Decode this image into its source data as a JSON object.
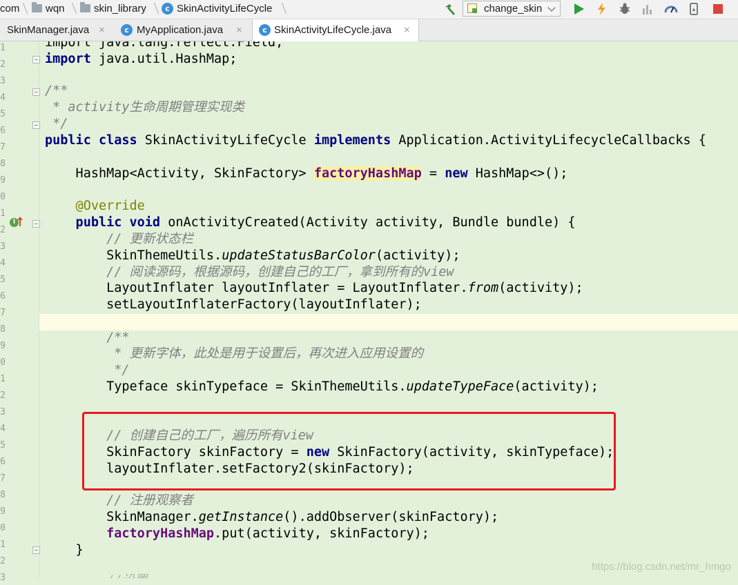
{
  "breadcrumb": {
    "items": [
      "com",
      "wqn",
      "skin_library",
      "SkinActivityLifeCycle"
    ],
    "class_icon_letter": "c"
  },
  "toolbar": {
    "run_config": "change_skin",
    "icons": [
      "build-hammer-icon",
      "run-icon",
      "apply-changes-icon",
      "debug-icon",
      "profile-icon",
      "attach-debugger-icon",
      "device-manager-icon",
      "stop-icon"
    ]
  },
  "tabs": [
    {
      "label": "SkinManager.java",
      "close": "×",
      "active": false
    },
    {
      "label": "MyApplication.java",
      "close": "×",
      "active": false
    },
    {
      "label": "SkinActivityLifeCycle.java",
      "close": "×",
      "active": true
    }
  ],
  "gutter": {
    "line_number_digits": [
      "1",
      "2",
      "3",
      "4",
      "5",
      "6",
      "7",
      "8",
      "9",
      "0",
      "1",
      "2",
      "3",
      "4",
      "5",
      "6",
      "7",
      "8",
      "9",
      "0",
      "1",
      "2",
      "3",
      "4",
      "5",
      "6",
      "7",
      "8",
      "9",
      "0",
      "1",
      "2",
      "3"
    ],
    "override_marker": "I"
  },
  "code": {
    "l01a": "import java.lang.reflect.Field;",
    "l02_kw": "import",
    "l02_rest": " java.util.HashMap;",
    "l04": "/**",
    "l05_star": " * ",
    "l05_word": "activity",
    "l05_cjk": "生命周期管理实现类",
    "l06": " */",
    "l07_kw1": "public class",
    "l07_name": " SkinActivityLifeCycle ",
    "l07_kw2": "implements",
    "l07_rest": " Application.ActivityLifecycleCallbacks {",
    "l09_type": "    HashMap<Activity, SkinFactory> ",
    "l09_field": "factoryHashMap",
    "l09_eq": " = ",
    "l09_kw": "new",
    "l09_rest": " HashMap<>();",
    "l11_ann": "    @Override",
    "l12_kw": "    public void",
    "l12_rest": " onActivityCreated(Activity activity, Bundle bundle) {",
    "l13_cmt": "        // 更新状态栏",
    "l14_a": "        SkinThemeUtils.",
    "l14_it": "updateStatusBarColor",
    "l14_b": "(activity);",
    "l15_cmt": "        // 阅读源码，根据源码，创建自己的工厂，拿到所有的view",
    "l16_a": "        LayoutInflater layoutInflater = LayoutInflater.",
    "l16_it": "from",
    "l16_b": "(activity);",
    "l17": "        setLayoutInflaterFactory(layoutInflater);",
    "l19_cmt": "        /**",
    "l20_cmt": "         * 更新字体，此处是用于设置后，再次进入应用设置的",
    "l21_cmt": "         */",
    "l22_a": "        Typeface skinTypeface = SkinThemeUtils.",
    "l22_it": "updateTypeFace",
    "l22_b": "(activity);",
    "l24_cmt": "        // 创建自己的工厂，遍历所有view",
    "l25_a": "        SkinFactory skinFactory = ",
    "l25_kw": "new",
    "l25_b": " SkinFactory(activity, skinTypeface);",
    "l26": "        layoutInflater.setFactory2(skinFactory);",
    "l28_cmt": "        // 注册观察者",
    "l29_a": "        SkinManager.",
    "l29_it": "getInstance",
    "l29_b": "().addObserver(skinFactory);",
    "l30_field": "        factoryHashMap",
    "l30_rest": ".put(activity, skinFactory);",
    "l31": "    }",
    "l33_cmt": "        //设置 ..."
  },
  "watermark": "https://blog.csdn.net/mr_hmgo",
  "colors": {
    "editor_bg": "#e3f1db",
    "keyword": "#000080",
    "comment": "#808080",
    "field": "#660e7a",
    "annotation": "#808000",
    "highlight_border": "#e8191c",
    "current_line": "#fefce4"
  }
}
